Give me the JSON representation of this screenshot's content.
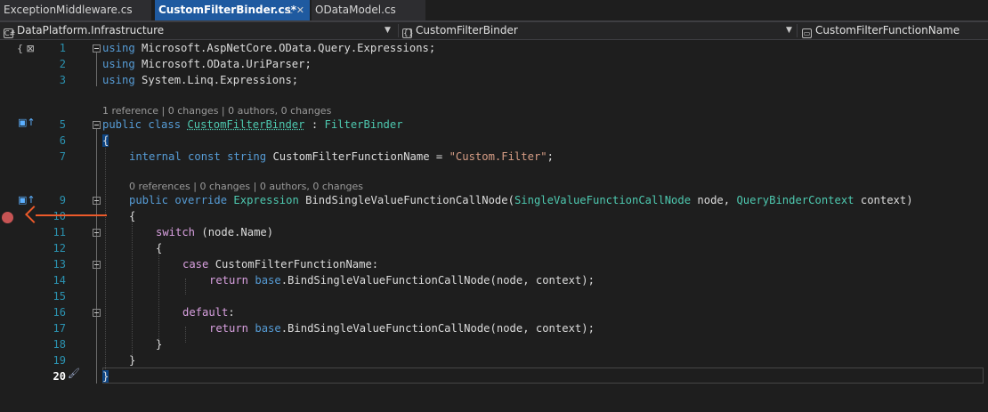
{
  "tabs": [
    {
      "label": "ExceptionMiddleware.cs",
      "active": false
    },
    {
      "label": "CustomFilterBinder.cs*",
      "active": true,
      "pin": "⊥ ✕"
    },
    {
      "label": "ODataModel.cs",
      "active": false
    }
  ],
  "navbar": {
    "project": "DataPlatform.Infrastructure",
    "type": "CustomFilterBinder",
    "member": "CustomFilterFunctionName"
  },
  "line_numbers": [
    "1",
    "2",
    "3",
    "5",
    "6",
    "7",
    "9",
    "10",
    "11",
    "12",
    "13",
    "14",
    "15",
    "16",
    "17",
    "18",
    "19",
    "20"
  ],
  "code_lens": {
    "class": "1 reference | 0 changes | 0 authors, 0 changes",
    "method": "0 references | 0 changes | 0 authors, 0 changes"
  },
  "code": {
    "l1_kw": "using",
    "l1_rest": " Microsoft.AspNetCore.OData.Query.Expressions;",
    "l2_kw": "using",
    "l2_rest": " Microsoft.OData.UriParser;",
    "l3_kw": "using",
    "l3_rest": " System.Linq.Expressions;",
    "l5_kw1": "public",
    "l5_kw2": " class ",
    "l5_type": "CustomFilterBinder",
    "l5_colon": " : ",
    "l5_base": "FilterBinder",
    "l6": "{",
    "l7_kw1": "internal",
    "l7_kw2": " const",
    "l7_kw3": " string",
    "l7_name": " CustomFilterFunctionName = ",
    "l7_str": "\"Custom.Filter\"",
    "l7_end": ";",
    "l9_kw1": "public",
    "l9_kw2": " override",
    "l9_type": " Expression",
    "l9_name": " BindSingleValueFunctionCallNode(",
    "l9_p1t": "SingleValueFunctionCallNode",
    "l9_p1n": " node, ",
    "l9_p2t": "QueryBinderContext",
    "l9_p2n": " context)",
    "l10": "{",
    "l11_kw": "switch",
    "l11_rest": " (node.Name)",
    "l12": "{",
    "l13_kw": "case",
    "l13_rest": " CustomFilterFunctionName:",
    "l14_kw": "return",
    "l14_kw2": " base",
    "l14_rest": ".BindSingleValueFunctionCallNode(node, context);",
    "l16_kw": "default",
    "l16_rest": ":",
    "l17_kw": "return",
    "l17_kw2": " base",
    "l17_rest": ".BindSingleValueFunctionCallNode(node, context);",
    "l18": "}",
    "l19": "}",
    "l20": "}"
  },
  "colors": {
    "keyword": "#569cd6",
    "control_keyword": "#d8a0df",
    "type": "#4ec9b0",
    "string": "#d69d85",
    "line_number": "#2b91af",
    "breakpoint": "#c75454",
    "annotation_arrow": "#ec5a2a",
    "active_tab": "#1f5aa0"
  },
  "icons": [
    "namespace-icon",
    "class-icon",
    "method-icon",
    "breakpoint-icon",
    "quick-action-icon"
  ]
}
